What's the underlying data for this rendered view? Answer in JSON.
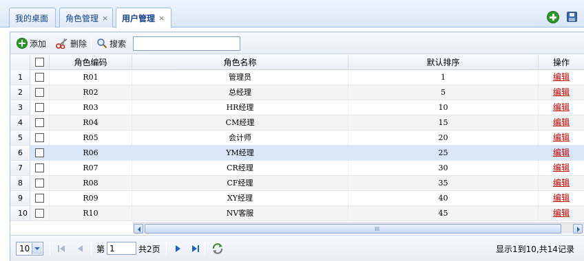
{
  "tabs": [
    {
      "label": "我的桌面",
      "closable": false,
      "active": false
    },
    {
      "label": "角色管理",
      "closable": true,
      "active": false
    },
    {
      "label": "用户管理",
      "closable": true,
      "active": true
    }
  ],
  "tab_close_glyph": "×",
  "toolbar": {
    "add_label": "添加",
    "delete_label": "删除",
    "search_label": "搜索",
    "search_value": ""
  },
  "grid": {
    "columns": [
      "角色编码",
      "角色名称",
      "默认排序",
      "操作"
    ],
    "rows": [
      {
        "num": "1",
        "code": "R01",
        "name": "管理员",
        "sort": "1",
        "action": "编辑"
      },
      {
        "num": "2",
        "code": "R02",
        "name": "总经理",
        "sort": "5",
        "action": "编辑"
      },
      {
        "num": "3",
        "code": "R03",
        "name": "HR经理",
        "sort": "10",
        "action": "编辑"
      },
      {
        "num": "4",
        "code": "R04",
        "name": "CM经理",
        "sort": "15",
        "action": "编辑"
      },
      {
        "num": "5",
        "code": "R05",
        "name": "会计师",
        "sort": "20",
        "action": "编辑"
      },
      {
        "num": "6",
        "code": "R06",
        "name": "YM经理",
        "sort": "25",
        "action": "编辑"
      },
      {
        "num": "7",
        "code": "R07",
        "name": "CR经理",
        "sort": "30",
        "action": "编辑"
      },
      {
        "num": "8",
        "code": "R08",
        "name": "CF经理",
        "sort": "35",
        "action": "编辑"
      },
      {
        "num": "9",
        "code": "R09",
        "name": "XY经理",
        "sort": "40",
        "action": "编辑"
      },
      {
        "num": "10",
        "code": "R10",
        "name": "NV客服",
        "sort": "45",
        "action": "编辑"
      }
    ],
    "selected_row": 6
  },
  "pager": {
    "page_size": "10",
    "page_label": "第",
    "page_value": "1",
    "page_total": "共2页",
    "info": "显示1到10,共14记录"
  },
  "colors": {
    "accent": "#15428b",
    "border": "#99bbe8",
    "link": "#c00000",
    "selected_row": "#d8e6f8"
  },
  "icons": {
    "add": "plus-circle-icon",
    "delete": "scissors-icon",
    "search": "magnifier-icon",
    "save": "floppy-disk-icon",
    "refresh": "refresh-icon"
  }
}
